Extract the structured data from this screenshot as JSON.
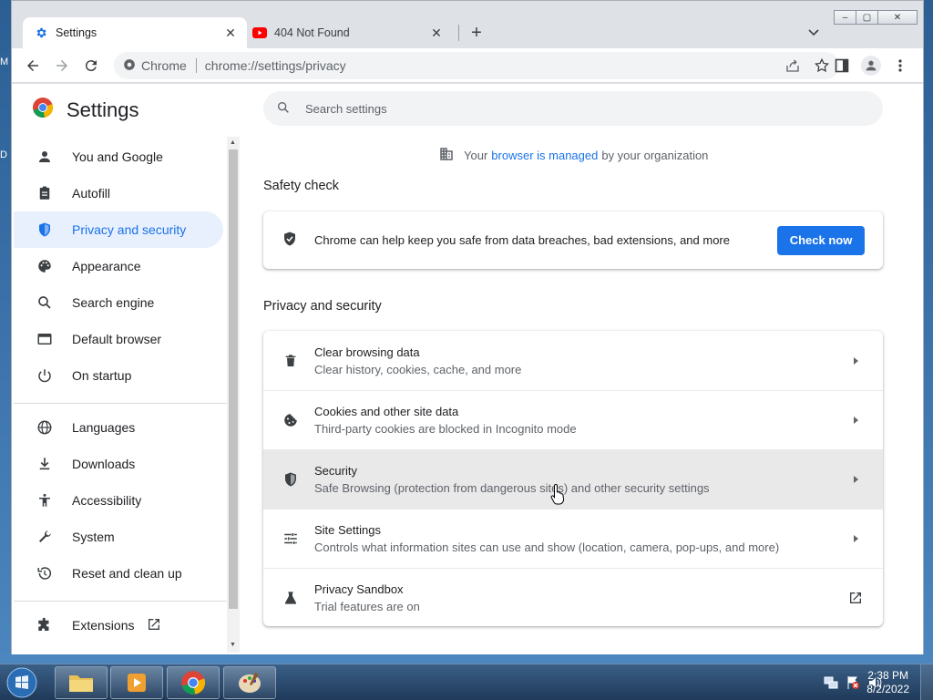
{
  "desktop": {
    "label_m": "M",
    "label_d": "D"
  },
  "tabs": [
    {
      "title": "Settings",
      "icon": "gear-icon",
      "active": true
    },
    {
      "title": "404 Not Found",
      "icon": "youtube-icon",
      "active": false
    }
  ],
  "new_tab": "+",
  "omnibox": {
    "site": "Chrome",
    "url": "chrome://settings/privacy"
  },
  "settings": {
    "title": "Settings",
    "search_placeholder": "Search settings",
    "managed": {
      "pre": "Your",
      "link": "browser is managed",
      "post": "by your organization"
    }
  },
  "sidebar": {
    "items": [
      {
        "label": "You and Google",
        "icon": "person-icon"
      },
      {
        "label": "Autofill",
        "icon": "clipboard-icon"
      },
      {
        "label": "Privacy and security",
        "icon": "shield-icon",
        "active": true
      },
      {
        "label": "Appearance",
        "icon": "palette-icon"
      },
      {
        "label": "Search engine",
        "icon": "search-icon"
      },
      {
        "label": "Default browser",
        "icon": "browser-icon"
      },
      {
        "label": "On startup",
        "icon": "power-icon"
      },
      {
        "label": "Languages",
        "icon": "globe-icon"
      },
      {
        "label": "Downloads",
        "icon": "download-icon"
      },
      {
        "label": "Accessibility",
        "icon": "accessibility-icon"
      },
      {
        "label": "System",
        "icon": "wrench-icon"
      },
      {
        "label": "Reset and clean up",
        "icon": "restore-icon"
      },
      {
        "label": "Extensions",
        "icon": "puzzle-icon"
      }
    ]
  },
  "safety_check": {
    "heading": "Safety check",
    "text": "Chrome can help keep you safe from data breaches, bad extensions, and more",
    "button": "Check now"
  },
  "privacy": {
    "heading": "Privacy and security",
    "rows": [
      {
        "title": "Clear browsing data",
        "subtitle": "Clear history, cookies, cache, and more",
        "icon": "trash-icon"
      },
      {
        "title": "Cookies and other site data",
        "subtitle": "Third-party cookies are blocked in Incognito mode",
        "icon": "cookie-icon"
      },
      {
        "title": "Security",
        "subtitle": "Safe Browsing (protection from dangerous sites) and other security settings",
        "icon": "shield-icon"
      },
      {
        "title": "Site Settings",
        "subtitle": "Controls what information sites can use and show (location, camera, pop-ups, and more)",
        "icon": "sliders-icon"
      },
      {
        "title": "Privacy Sandbox",
        "subtitle": "Trial features are on",
        "icon": "flask-icon"
      }
    ]
  },
  "taskbar": {
    "time": "2:38 PM",
    "date": "8/2/2022"
  },
  "colors": {
    "accent": "#1a73e8",
    "active_bg": "#e8f0fe",
    "hover_row": "#e9e9ea"
  }
}
